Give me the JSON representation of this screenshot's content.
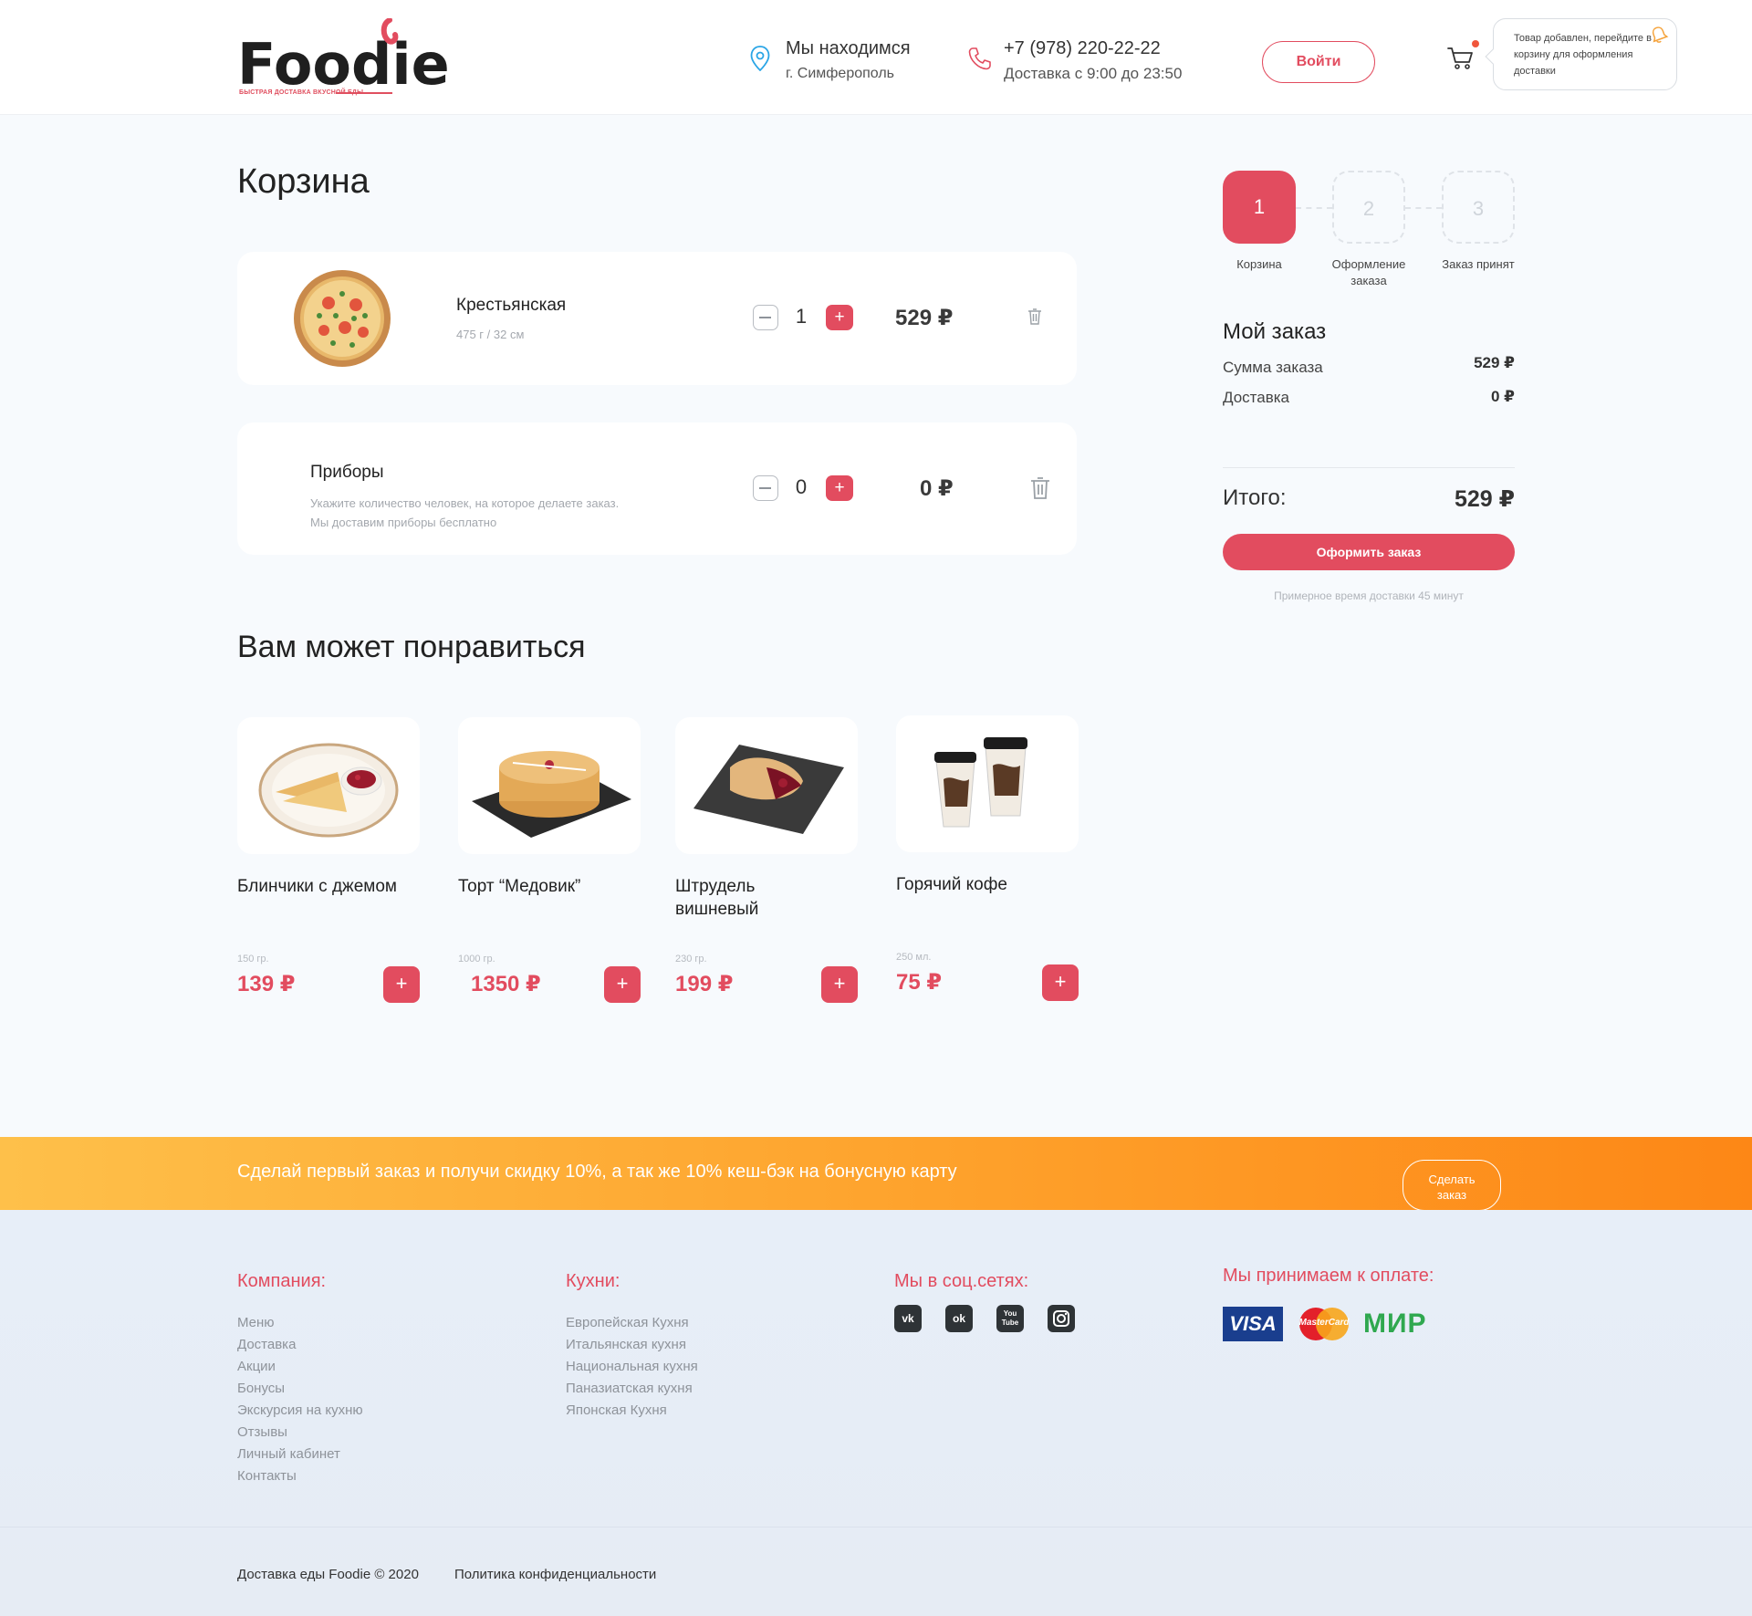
{
  "header": {
    "logo_text": "Foodie",
    "logo_tagline": "БЫСТРАЯ ДОСТАВКА ВКУСНОЙ ЕДЫ",
    "location_title": "Мы находимся",
    "location_city": "г. Симферополь",
    "phone": "+7 (978) 220-22-22",
    "delivery_hours": "Доставка с 9:00 до 23:50",
    "login_label": "Войти",
    "toast_text": "Товар добавлен, перейдите в корзину для оформления доставки"
  },
  "cart": {
    "title": "Корзина",
    "items": [
      {
        "name": "Крестьянская",
        "desc": "475 г / 32 см",
        "qty": "1",
        "price": "529 ₽",
        "image": "pizza"
      }
    ],
    "cutlery": {
      "name": "Приборы",
      "desc_line1": "Укажите количество человек, на которое делаете заказ.",
      "desc_line2": "Мы доставим приборы бесплатно",
      "qty": "0",
      "price": "0 ₽"
    }
  },
  "steps": [
    {
      "number": "1",
      "label": "Корзина",
      "active": true
    },
    {
      "number": "2",
      "label": "Оформление заказа",
      "active": false
    },
    {
      "number": "3",
      "label": "Заказ принят",
      "active": false
    }
  ],
  "summary": {
    "title": "Мой заказ",
    "order_sum_label": "Сумма заказа",
    "order_sum_value": "529 ₽",
    "delivery_label": "Доставка",
    "delivery_value": "0 ₽",
    "total_label": "Итого:",
    "total_value": "529 ₽",
    "checkout_label": "Оформить заказ",
    "eta": "Примерное время доставки 45 минут"
  },
  "recommended": {
    "title": "Вам может понравиться",
    "items": [
      {
        "name": "Блинчики с джемом",
        "weight": "150 гр.",
        "price": "139 ₽",
        "image": "pancakes"
      },
      {
        "name": "Торт “Медовик”",
        "weight": "1000 гр.",
        "price": "1350 ₽",
        "image": "honey-cake"
      },
      {
        "name": "Штрудель вишневый",
        "weight": "230 гр.",
        "price": "199 ₽",
        "image": "strudel"
      },
      {
        "name": "Горячий кофе",
        "weight": "250 мл.",
        "price": "75 ₽",
        "image": "coffee-cups"
      }
    ],
    "add_label": "+"
  },
  "promo": {
    "text": "Сделай первый заказ и получи скидку 10%, а так же 10% кеш-бэк на бонусную карту",
    "button_line1": "Сделать",
    "button_line2": "заказ"
  },
  "footer": {
    "company_title": "Компания:",
    "company_links": [
      "Меню",
      "Доставка",
      "Акции",
      "Бонусы",
      "Экскурсия на кухню",
      "Отзывы",
      "Личный кабинет",
      "Контакты"
    ],
    "cuisines_title": "Кухни:",
    "cuisines_links": [
      "Европейская Кухня",
      "Итальянская кухня",
      "Национальная кухня",
      "Паназиатская кухня",
      "Японская Кухня"
    ],
    "social_title": "Мы в соц.сетях:",
    "social": [
      "vk-icon",
      "odnoklassniki-icon",
      "youtube-icon",
      "instagram-icon"
    ],
    "payment_title": "Мы принимаем к оплате:",
    "payment": [
      "VISA",
      "MasterCard",
      "МИР"
    ],
    "copyright": "Доставка еды Foodie © 2020",
    "policy": "Политика конфиденциальности"
  },
  "colors": {
    "accent": "#e24c5f",
    "promo_start": "#fec04a",
    "promo_end": "#fd8716"
  }
}
